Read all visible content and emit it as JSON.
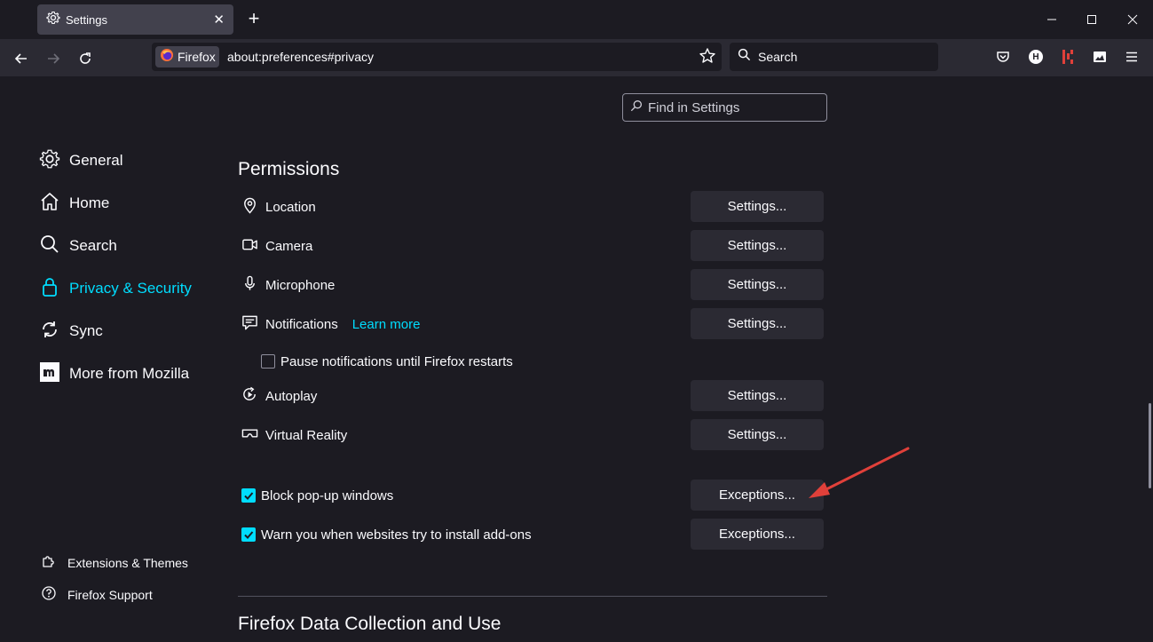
{
  "tab": {
    "title": "Settings",
    "close": "✕"
  },
  "newtab": "+",
  "identity_label": "Firefox",
  "url": "about:preferences#privacy",
  "search_placeholder": "Search",
  "toolbar_icons": [
    "pocket-icon",
    "honey-icon",
    "extension-icon",
    "screenshot-icon",
    "menu-icon"
  ],
  "honey_letter": "H",
  "find_placeholder": "Find in Settings",
  "categories": [
    {
      "label": "General",
      "icon": "gear-icon"
    },
    {
      "label": "Home",
      "icon": "home-icon"
    },
    {
      "label": "Search",
      "icon": "search-icon"
    },
    {
      "label": "Privacy & Security",
      "icon": "lock-icon",
      "active": true
    },
    {
      "label": "Sync",
      "icon": "sync-icon"
    },
    {
      "label": "More from Mozilla",
      "icon": "mozilla-icon"
    }
  ],
  "footer_links": [
    {
      "label": "Extensions & Themes",
      "icon": "puzzle-icon"
    },
    {
      "label": "Firefox Support",
      "icon": "help-icon"
    }
  ],
  "permissions": {
    "heading": "Permissions",
    "rows": [
      {
        "label": "Location",
        "icon": "location-icon",
        "button": "Settings..."
      },
      {
        "label": "Camera",
        "icon": "camera-icon",
        "button": "Settings..."
      },
      {
        "label": "Microphone",
        "icon": "microphone-icon",
        "button": "Settings..."
      },
      {
        "label": "Notifications",
        "icon": "notifications-icon",
        "button": "Settings...",
        "link": "Learn more"
      },
      {
        "label": "Autoplay",
        "icon": "autoplay-icon",
        "button": "Settings..."
      },
      {
        "label": "Virtual Reality",
        "icon": "vr-icon",
        "button": "Settings..."
      }
    ],
    "pause_notifications": {
      "label": "Pause notifications until Firefox restarts",
      "checked": false
    },
    "block_popups": {
      "label": "Block pop-up windows",
      "checked": true,
      "button": "Exceptions..."
    },
    "warn_addons": {
      "label": "Warn you when websites try to install add-ons",
      "checked": true,
      "button": "Exceptions..."
    }
  },
  "data_collection_heading": "Firefox Data Collection and Use",
  "colors": {
    "accent": "#00ddff",
    "background": "#1c1b22",
    "toolbar": "#2b2a33",
    "button": "#2b2a33",
    "annotation_arrow": "#e0403a"
  }
}
